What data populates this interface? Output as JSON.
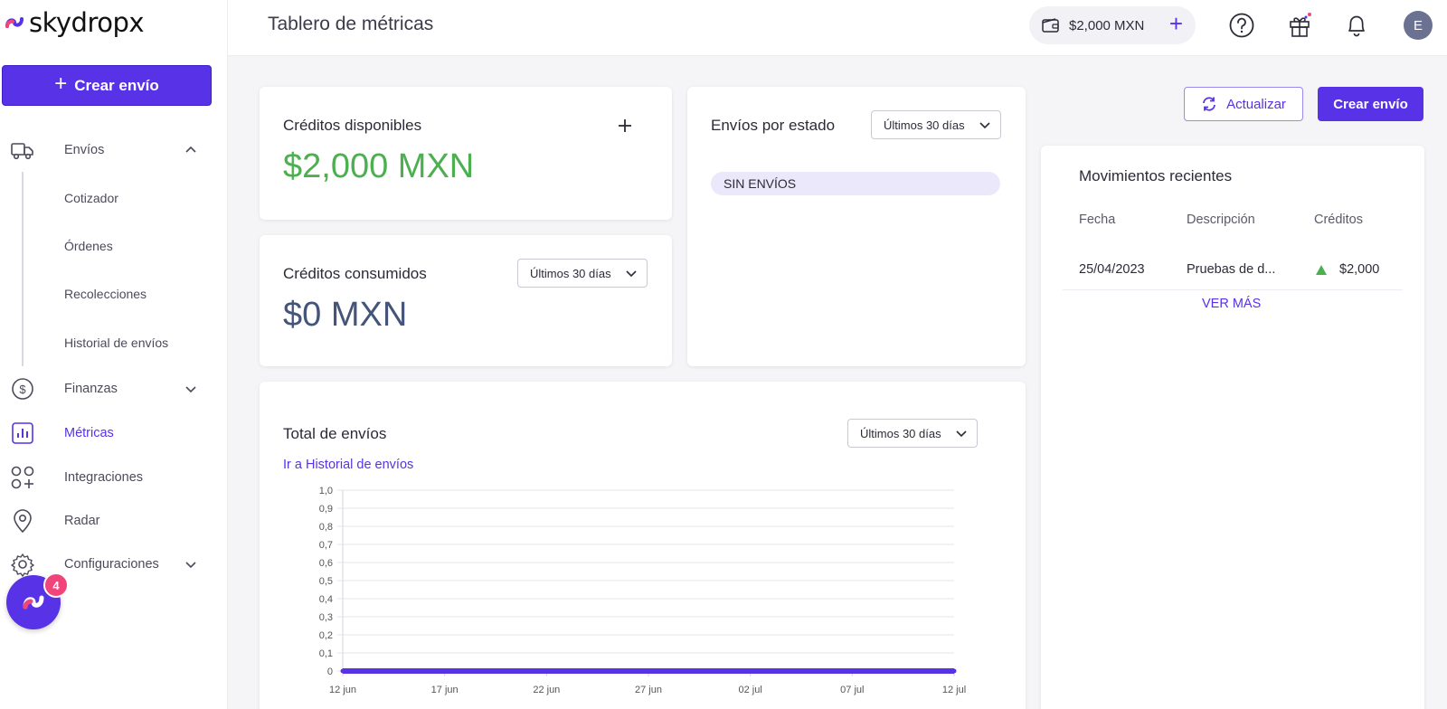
{
  "brand": {
    "name": "skydropx"
  },
  "sidebar": {
    "create_label": "Crear envío",
    "items": [
      {
        "label": "Envíos",
        "icon": "truck-icon"
      },
      {
        "label": "Finanzas",
        "icon": "dollar-circle-icon"
      },
      {
        "label": "Métricas",
        "icon": "bar-chart-icon"
      },
      {
        "label": "Integraciones",
        "icon": "apps-plus-icon"
      },
      {
        "label": "Radar",
        "icon": "location-pin-icon"
      },
      {
        "label": "Configuraciones",
        "icon": "gear-icon"
      }
    ],
    "sub_items": [
      "Cotizador",
      "Órdenes",
      "Recolecciones",
      "Historial de envíos"
    ],
    "chat_badge": "4"
  },
  "topbar": {
    "title": "Tablero de métricas",
    "balance": "$2,000 MXN",
    "avatar_initial": "E"
  },
  "credits_available": {
    "title": "Créditos disponibles",
    "amount": "$2,000 MXN"
  },
  "credits_consumed": {
    "title": "Créditos consumidos",
    "range": "Últimos 30 días",
    "amount": "$0 MXN"
  },
  "shipments_by_status": {
    "title": "Envíos por estado",
    "range": "Últimos 30 días",
    "empty_label": "SIN ENVÍOS"
  },
  "total_shipments": {
    "title": "Total de envíos",
    "range": "Últimos 30 días",
    "link": "Ir a Historial de envíos"
  },
  "actions": {
    "refresh_label": "Actualizar",
    "create_label": "Crear envío"
  },
  "recent_movements": {
    "title": "Movimientos recientes",
    "columns": [
      "Fecha",
      "Descripción",
      "Créditos"
    ],
    "rows": [
      {
        "date": "25/04/2023",
        "description": "Pruebas de d...",
        "credits": "$2,000",
        "direction": "up"
      }
    ],
    "more_label": "VER MÁS"
  },
  "colors": {
    "accent": "#5732e6",
    "positive": "#4caf50",
    "badge": "#f0447a"
  },
  "chart_data": {
    "type": "area",
    "title": "",
    "xlabel": "",
    "ylabel": "",
    "x": [
      "12 jun",
      "17 jun",
      "22 jun",
      "27 jun",
      "02 jul",
      "07 jul",
      "12 jul"
    ],
    "y_ticks": [
      "1,0",
      "0,9",
      "0,8",
      "0,7",
      "0,6",
      "0,5",
      "0,4",
      "0,3",
      "0,2",
      "0,1",
      "0"
    ],
    "ylim": [
      0,
      1
    ],
    "series": [
      {
        "values": [
          0,
          0,
          0,
          0,
          0,
          0,
          0
        ],
        "color": "#5732e6"
      }
    ],
    "grid": true
  }
}
